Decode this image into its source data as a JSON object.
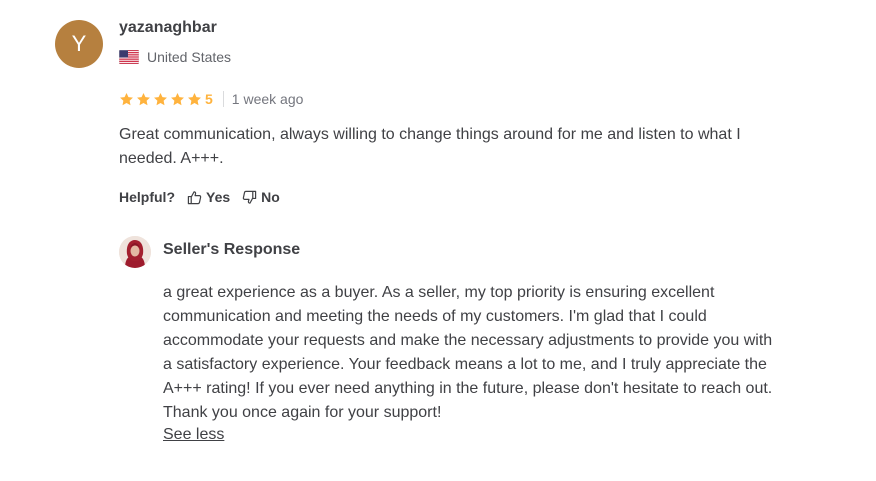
{
  "review": {
    "avatar_initial": "Y",
    "avatar_color": "#b6803f",
    "username": "yazanaghbar",
    "country": "United States",
    "country_flag_icon": "us-flag-icon",
    "rating": "5",
    "star_count": 5,
    "star_color": "#ffb33e",
    "time_ago": "1 week ago",
    "text": "Great communication, always willing to change things around for me and listen to what I needed. A+++."
  },
  "helpful": {
    "label": "Helpful?",
    "yes_label": "Yes",
    "no_label": "No"
  },
  "seller_response": {
    "title": "Seller's Response",
    "text": "a great experience as a buyer. As a seller, my top priority is ensuring excellent communication and meeting the needs of my customers. I'm glad that I could accommodate your requests and make the necessary adjustments to provide you with a satisfactory experience. Your feedback means a lot to me, and I truly appreciate the A+++ rating! If you ever need anything in the future, please don't hesitate to reach out. Thank you once again for your support!",
    "see_less_label": "See less"
  }
}
